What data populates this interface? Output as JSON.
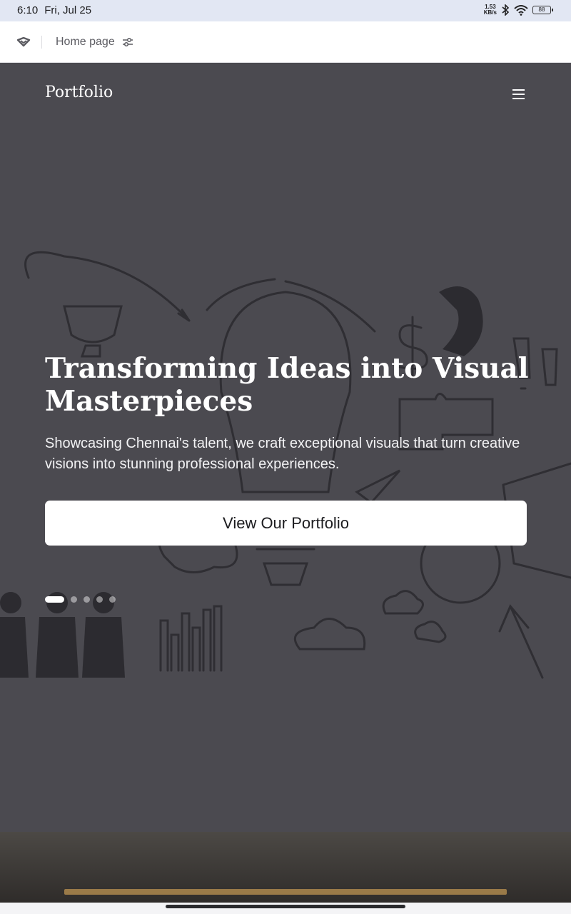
{
  "status_bar": {
    "time": "6:10",
    "date": "Fri, Jul 25",
    "net_speed_value": "1.53",
    "net_speed_unit": "KB/s",
    "battery": "88",
    "icons": [
      "bluetooth-icon",
      "wifi-icon",
      "battery-icon"
    ]
  },
  "browser": {
    "title": "Home page",
    "icons": [
      "app-logo-icon",
      "tune-icon"
    ]
  },
  "site": {
    "brand": "Portfolio",
    "menu_icon": "hamburger-menu-icon"
  },
  "hero": {
    "headline": "Transforming Ideas into Visual Masterpieces",
    "subtext": "Showcasing Chennai's talent, we craft exceptional visuals that turn creative visions into stunning professional experiences.",
    "cta_label": "View Our Portfolio",
    "slide_count": 5,
    "active_slide": 1
  },
  "colors": {
    "hero_overlay": "#4b4a50",
    "status_bar_bg": "#e2e7f3",
    "cta_bg": "#ffffff"
  }
}
